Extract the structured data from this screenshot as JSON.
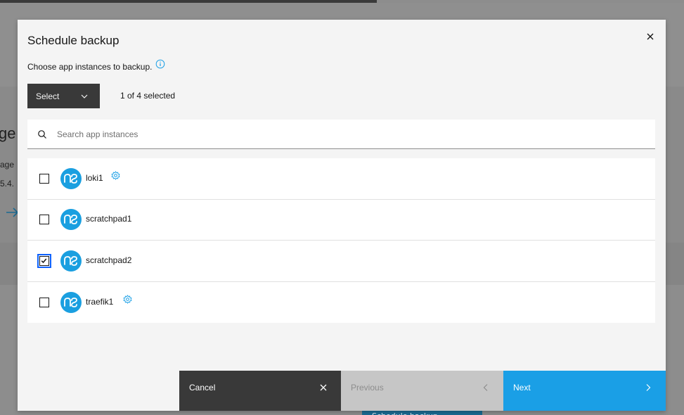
{
  "modal": {
    "title": "Schedule backup",
    "subtitle": "Choose app instances to backup.",
    "select_label": "Select",
    "selected_count": "1 of 4 selected",
    "search_placeholder": "Search app instances"
  },
  "instances": [
    {
      "name": "loki1",
      "checked": false,
      "configurable": true
    },
    {
      "name": "scratchpad1",
      "checked": false,
      "configurable": false
    },
    {
      "name": "scratchpad2",
      "checked": true,
      "configurable": false
    },
    {
      "name": "traefik1",
      "checked": false,
      "configurable": true
    }
  ],
  "footer": {
    "cancel_label": "Cancel",
    "previous_label": "Previous",
    "next_label": "Next"
  },
  "background": {
    "heading_fragment": "ge",
    "line1_fragment": "age",
    "line2_fragment": "5.4.",
    "button_fragment": "Schedule backup"
  },
  "colors": {
    "accent": "#1a9fe6",
    "checkbox_focus": "#0f62fe",
    "dark_button": "#393939",
    "disabled_button": "#c6c6c6"
  },
  "icons": {
    "close": "close-icon",
    "info": "info-icon",
    "chevron": "chevron-down-icon",
    "search": "search-icon",
    "app": "nethserver-app-icon",
    "settings": "settings-icon"
  }
}
